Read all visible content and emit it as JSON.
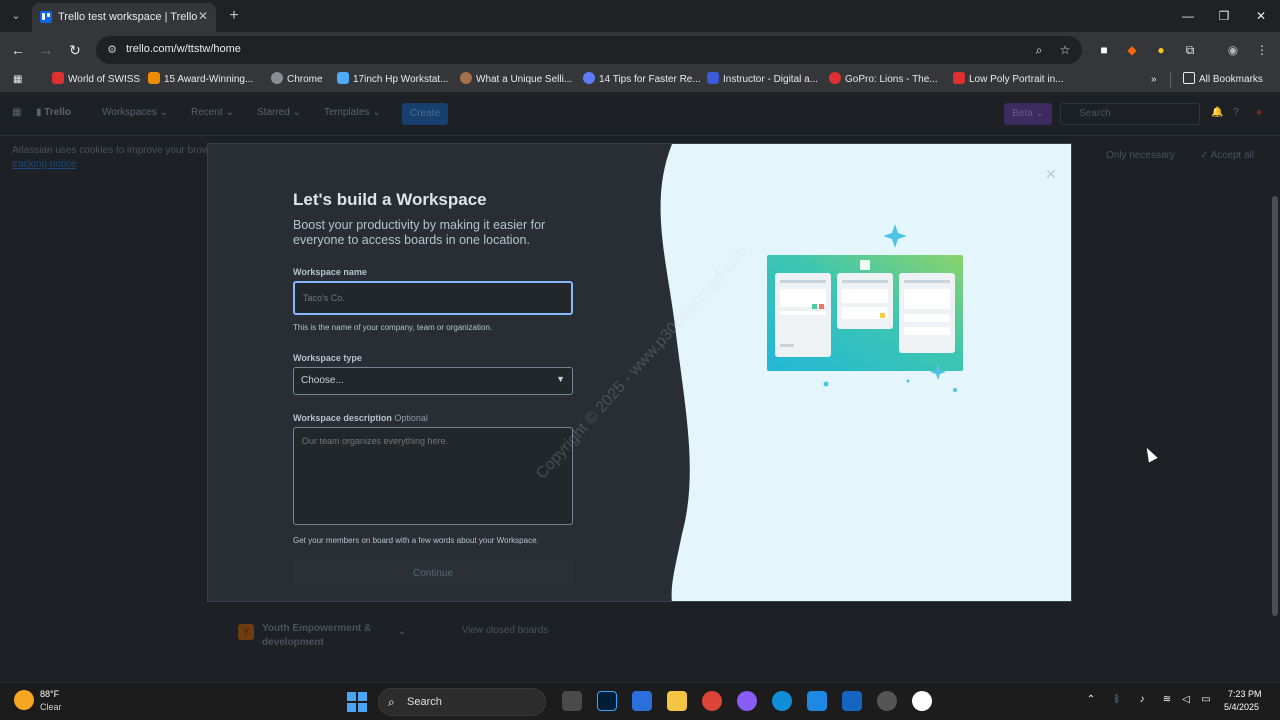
{
  "browser": {
    "tab_title": "Trello test workspace | Trello",
    "url": "trello.com/w/ttstw/home",
    "bookmarks": [
      {
        "label": "World of SWISS",
        "color": "#e03131"
      },
      {
        "label": "15 Award-Winning...",
        "color": "#f08c00"
      },
      {
        "label": "Chrome",
        "color": "#868e96"
      },
      {
        "label": "17inch Hp Workstat...",
        "color": "#4dabf7"
      },
      {
        "label": "What a Unique Selli...",
        "color": "#a47148"
      },
      {
        "label": "14 Tips for Faster Re...",
        "color": "#5c7cfa"
      },
      {
        "label": "Instructor - Digital a...",
        "color": "#3b5bdb"
      },
      {
        "label": "GoPro: Lions - The...",
        "color": "#e03131"
      },
      {
        "label": "Low Poly Portrait in...",
        "color": "#e03131"
      }
    ],
    "all_bookmarks": "All Bookmarks"
  },
  "trello": {
    "logo": "Trello",
    "nav": [
      "Workspaces",
      "Recent",
      "Starred",
      "Templates"
    ],
    "create": "Create",
    "beta": "Beta",
    "search_placeholder": "Search",
    "cookie_text": "Atlassian uses cookies to improve your brow",
    "cookie_link": "tracking notice",
    "only_necessary": "Only necessary",
    "accept_all": "Accept all",
    "workspace_row": {
      "badge": "Y",
      "name": "Youth Empowerment & development"
    },
    "view_closed": "View closed boards"
  },
  "modal": {
    "title": "Let's build a Workspace",
    "subtitle": "Boost your productivity by making it easier for everyone to access boards in one location.",
    "name_label": "Workspace name",
    "name_placeholder": "Taco's Co.",
    "name_help": "This is the name of your company, team or organization.",
    "type_label": "Workspace type",
    "type_value": "Choose...",
    "desc_label": "Workspace description",
    "desc_optional": "Optional",
    "desc_placeholder": "Our team organizes everything here.",
    "desc_help": "Get your members on board with a few words about your Workspace.",
    "continue": "Continue",
    "watermark": "Copyright © 2025 - www.p30download.com"
  },
  "taskbar": {
    "temp": "88°F",
    "condition": "Clear",
    "search": "Search",
    "time": "7:23 PM",
    "date": "5/4/2025"
  },
  "colors": {
    "accent": "#85b8ff",
    "trello_blue": "#0c66e4",
    "illustration_bg": "#e4f6fb"
  }
}
